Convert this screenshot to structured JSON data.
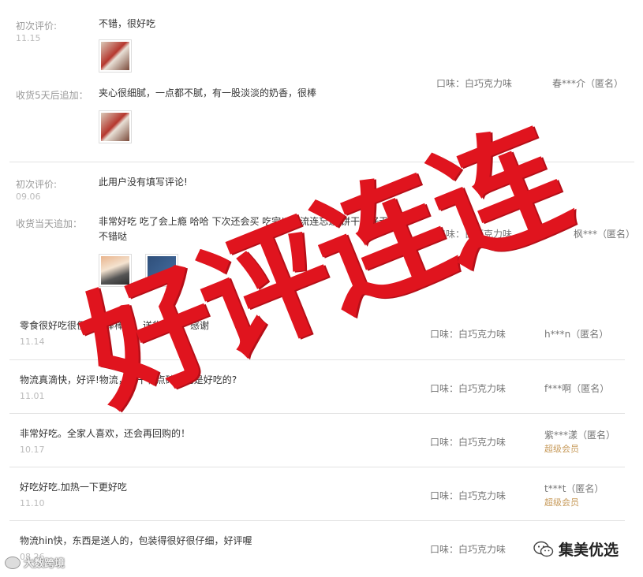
{
  "review1": {
    "initial_label": "初次评价:",
    "initial_date": "11.15",
    "initial_text": "不错，很好吃",
    "followup_label": "收货5天后追加：",
    "followup_text": "夹心很细腻，一点都不腻，有一股淡淡的奶香，很棒",
    "spec": "口味：白巧克力味",
    "user": "春***介（匿名）"
  },
  "review2": {
    "initial_label": "初次评价:",
    "initial_date": "09.06",
    "initial_text": "此用户没有填写评论!",
    "followup_label": "收货当天追加：",
    "followup_text_1": "非常好吃 吃了会上瘾 哈哈 下次还会买 吃完以后流连忘返 饼干完好无损",
    "followup_text_2": "不错哒",
    "spec": "口味：白巧克力味",
    "user": "枫***（匿名）"
  },
  "rows": [
    {
      "text": "零食很好吃很便宜，棒棒哒。送货上门，感谢",
      "date": "11.14",
      "spec": "口味：白巧克力味",
      "user": "h***n（匿名）",
      "badge": ""
    },
    {
      "text": "物流真滴快，好评!物流，饼干有点碎但也是好吃的?",
      "date": "11.01",
      "spec": "口味：白巧克力味",
      "user": "f***啊（匿名）",
      "badge": ""
    },
    {
      "text": "非常好吃。全家人喜欢，还会再回购的！",
      "date": "10.17",
      "spec": "口味：白巧克力味",
      "user": "紫***漾（匿名）",
      "badge": "超级会员"
    },
    {
      "text": "好吃好吃.加热一下更好吃",
      "date": "11.10",
      "spec": "口味：白巧克力味",
      "user": "t***t（匿名）",
      "badge": "超级会员"
    },
    {
      "text": "物流hin快，东西是送人的，包装得很好很仔细，好评喔",
      "date": "08.26",
      "spec": "口味：白巧克力味",
      "user": "",
      "badge": ""
    }
  ],
  "overlay_text": "好评连连",
  "watermark_left": "大数跨境",
  "watermark_right": "集美优选",
  "colors": {
    "accent_red": "#e0141e",
    "vip_gold": "#c79a5a"
  }
}
